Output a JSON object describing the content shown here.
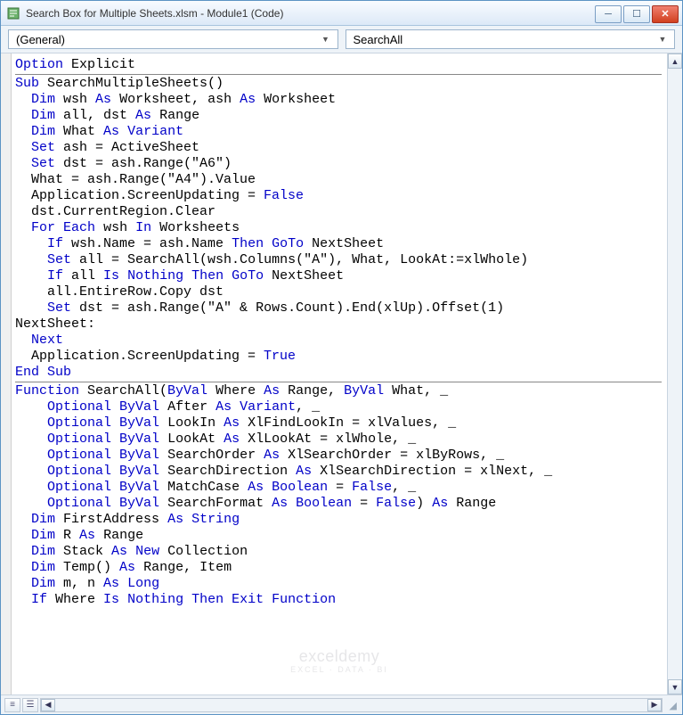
{
  "window": {
    "title": "Search Box for Multiple Sheets.xlsm - Module1 (Code)"
  },
  "dropdowns": {
    "left": "(General)",
    "right": "SearchAll"
  },
  "code_tokens": {
    "t0": "Option",
    "t1": " Explicit",
    "t2": "Sub",
    "t3": " SearchMultipleSheets()",
    "t4": "  ",
    "t5": "Dim",
    "t6": " wsh ",
    "t7": "As",
    "t8": " Worksheet, ash ",
    "t9": "As",
    "t10": " Worksheet",
    "t11": "  ",
    "t12": "Dim",
    "t13": " all, dst ",
    "t14": "As",
    "t15": " Range",
    "t16": "  ",
    "t17": "Dim",
    "t18": " What ",
    "t19": "As",
    "t20": " ",
    "t21": "Variant",
    "t22": "  ",
    "t23": "Set",
    "t24": " ash = ActiveSheet",
    "t25": "  ",
    "t26": "Set",
    "t27": " dst = ash.Range(\"A6\")",
    "t28": "  What = ash.Range(\"A4\").Value",
    "t29": "  Application.ScreenUpdating = ",
    "t30": "False",
    "t31": "  dst.CurrentRegion.Clear",
    "t32": "  ",
    "t33": "For",
    "t34": " ",
    "t35": "Each",
    "t36": " wsh ",
    "t37": "In",
    "t38": " Worksheets",
    "t39": "    ",
    "t40": "If",
    "t41": " wsh.Name = ash.Name ",
    "t42": "Then",
    "t43": " ",
    "t44": "GoTo",
    "t45": " NextSheet",
    "t46": "    ",
    "t47": "Set",
    "t48": " all = SearchAll(wsh.Columns(\"A\"), What, LookAt:=xlWhole)",
    "t49": "    ",
    "t50": "If",
    "t51": " all ",
    "t52": "Is",
    "t53": " ",
    "t54": "Nothing",
    "t55": " ",
    "t56": "Then",
    "t57": " ",
    "t58": "GoTo",
    "t59": " NextSheet",
    "t60": "    all.EntireRow.Copy dst",
    "t61": "    ",
    "t62": "Set",
    "t63": " dst = ash.Range(\"A\" & Rows.Count).End(xlUp).Offset(1)",
    "t64": "NextSheet:",
    "t65": "  ",
    "t66": "Next",
    "t67": "  Application.ScreenUpdating = ",
    "t68": "True",
    "t69": "End Sub",
    "t70": "Function",
    "t71": " SearchAll(",
    "t72": "ByVal",
    "t73": " Where ",
    "t74": "As",
    "t75": " Range, ",
    "t76": "ByVal",
    "t77": " What, _",
    "t78": "    ",
    "t79": "Optional",
    "t80": " ",
    "t81": "ByVal",
    "t82": " After ",
    "t83": "As",
    "t84": " ",
    "t85": "Variant",
    "t86": ", _",
    "t87": "    ",
    "t88": "Optional",
    "t89": " ",
    "t90": "ByVal",
    "t91": " LookIn ",
    "t92": "As",
    "t93": " XlFindLookIn = xlValues, _",
    "t94": "    ",
    "t95": "Optional",
    "t96": " ",
    "t97": "ByVal",
    "t98": " LookAt ",
    "t99": "As",
    "t100": " XlLookAt = xlWhole, _",
    "t101": "    ",
    "t102": "Optional",
    "t103": " ",
    "t104": "ByVal",
    "t105": " SearchOrder ",
    "t106": "As",
    "t107": " XlSearchOrder = xlByRows, _",
    "t108": "    ",
    "t109": "Optional",
    "t110": " ",
    "t111": "ByVal",
    "t112": " SearchDirection ",
    "t113": "As",
    "t114": " XlSearchDirection = xlNext, _",
    "t115": "    ",
    "t116": "Optional",
    "t117": " ",
    "t118": "ByVal",
    "t119": " MatchCase ",
    "t120": "As",
    "t121": " ",
    "t122": "Boolean",
    "t123": " = ",
    "t124": "False",
    "t125": ", _",
    "t126": "    ",
    "t127": "Optional",
    "t128": " ",
    "t129": "ByVal",
    "t130": " SearchFormat ",
    "t131": "As",
    "t132": " ",
    "t133": "Boolean",
    "t134": " = ",
    "t135": "False",
    "t136": ") ",
    "t137": "As",
    "t138": " Range",
    "t139": "  ",
    "t140": "Dim",
    "t141": " FirstAddress ",
    "t142": "As",
    "t143": " ",
    "t144": "String",
    "t145": "  ",
    "t146": "Dim",
    "t147": " R ",
    "t148": "As",
    "t149": " Range",
    "t150": "  ",
    "t151": "Dim",
    "t152": " Stack ",
    "t153": "As",
    "t154": " ",
    "t155": "New",
    "t156": " Collection",
    "t157": "  ",
    "t158": "Dim",
    "t159": " Temp() ",
    "t160": "As",
    "t161": " Range, Item",
    "t162": "  ",
    "t163": "Dim",
    "t164": " m, n ",
    "t165": "As",
    "t166": " ",
    "t167": "Long",
    "t168": "  ",
    "t169": "If",
    "t170": " Where ",
    "t171": "Is",
    "t172": " ",
    "t173": "Nothing",
    "t174": " ",
    "t175": "Then",
    "t176": " ",
    "t177": "Exit Function"
  },
  "watermark": {
    "name": "exceldemy",
    "tagline": "EXCEL · DATA · BI"
  }
}
